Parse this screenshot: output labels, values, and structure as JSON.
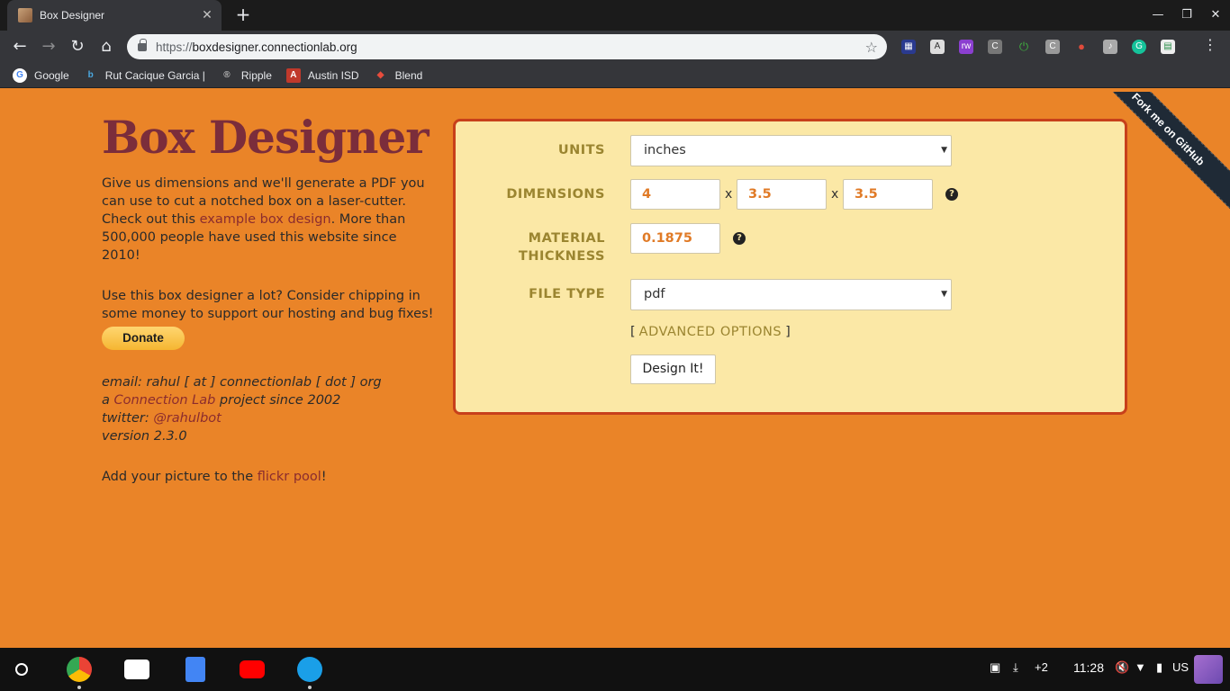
{
  "browser": {
    "tab_title": "Box Designer",
    "url_scheme": "https://",
    "url_host": "boxdesigner.connectionlab.org",
    "bookmarks": [
      {
        "label": "Google",
        "icon": "google-icon"
      },
      {
        "label": "Rut Cacique Garcia |",
        "icon": "b-icon"
      },
      {
        "label": "Ripple",
        "icon": "ripple-icon"
      },
      {
        "label": "Austin ISD",
        "icon": "austin-isd-icon"
      },
      {
        "label": "Blend",
        "icon": "blend-icon"
      }
    ]
  },
  "page": {
    "title": "Box Designer",
    "intro_before": "Give us dimensions and we'll generate a PDF you can use to cut a notched box on a laser-cutter. Check out this ",
    "intro_link": "example box design",
    "intro_after": ". More than 500,000 people have used this website since 2010!",
    "support_text": "Use this box designer a lot? Consider chipping in some money to support our hosting and bug fixes!",
    "donate_label": "Donate",
    "email_line": "email: rahul [ at ] connectionlab [ dot ] org",
    "project_before": "a ",
    "project_link": "Connection Lab",
    "project_after": " project since 2002",
    "twitter_label": "twitter: ",
    "twitter_link": "@rahulbot",
    "version": "version 2.3.0",
    "flickr_before": "Add your picture to the ",
    "flickr_link": "flickr pool",
    "flickr_after": "!",
    "ribbon": "Fork me on GitHub"
  },
  "form": {
    "units_label": "UNITS",
    "units_value": "inches",
    "dimensions_label": "DIMENSIONS",
    "dim_w": "4",
    "dim_h": "3.5",
    "dim_d": "3.5",
    "times": "x",
    "thickness_label_1": "MATERIAL",
    "thickness_label_2": "THICKNESS",
    "thickness_value": "0.1875",
    "filetype_label": "FILE TYPE",
    "filetype_value": "pdf",
    "advanced_open": "[",
    "advanced_label": "ADVANCED OPTIONS",
    "advanced_close": "]",
    "design_button": "Design It!",
    "help_glyph": "?"
  },
  "shelf": {
    "notifications": "+2",
    "time": "11:28",
    "locale": "US"
  }
}
